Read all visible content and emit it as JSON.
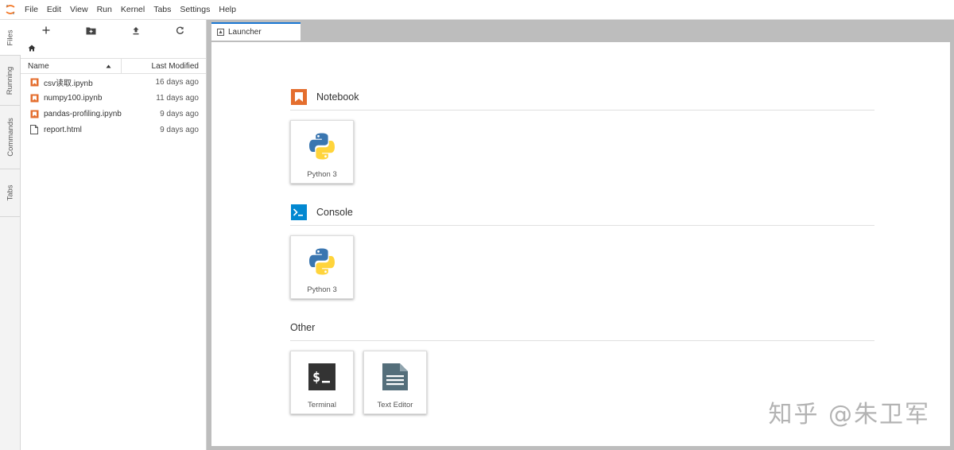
{
  "menubar": {
    "items": [
      "File",
      "Edit",
      "View",
      "Run",
      "Kernel",
      "Tabs",
      "Settings",
      "Help"
    ]
  },
  "side_tabs": [
    "Files",
    "Running",
    "Commands",
    "Tabs"
  ],
  "filebrowser": {
    "toolbar_icons": [
      "plus-icon",
      "new-folder-icon",
      "upload-icon",
      "refresh-icon"
    ],
    "breadcrumb_icon": "home-icon",
    "columns": {
      "name": "Name",
      "modified": "Last Modified"
    },
    "files": [
      {
        "name": "csv读取.ipynb",
        "modified": "16 days ago",
        "type": "notebook"
      },
      {
        "name": "numpy100.ipynb",
        "modified": "11 days ago",
        "type": "notebook"
      },
      {
        "name": "pandas-profiling.ipynb",
        "modified": "9 days ago",
        "type": "notebook"
      },
      {
        "name": "report.html",
        "modified": "9 days ago",
        "type": "file"
      }
    ]
  },
  "tabs": [
    {
      "label": "Launcher"
    }
  ],
  "launcher": {
    "notebook": {
      "title": "Notebook",
      "cards": [
        "Python 3"
      ]
    },
    "console": {
      "title": "Console",
      "cards": [
        "Python 3"
      ]
    },
    "other": {
      "title": "Other",
      "cards": [
        "Terminal",
        "Text Editor"
      ]
    }
  },
  "watermark": "知乎 @朱卫军",
  "colors": {
    "accent": "#1976d2",
    "notebook": "#e46e2e",
    "console": "#0288d1",
    "terminal": "#333333",
    "editor": "#546e7a"
  }
}
